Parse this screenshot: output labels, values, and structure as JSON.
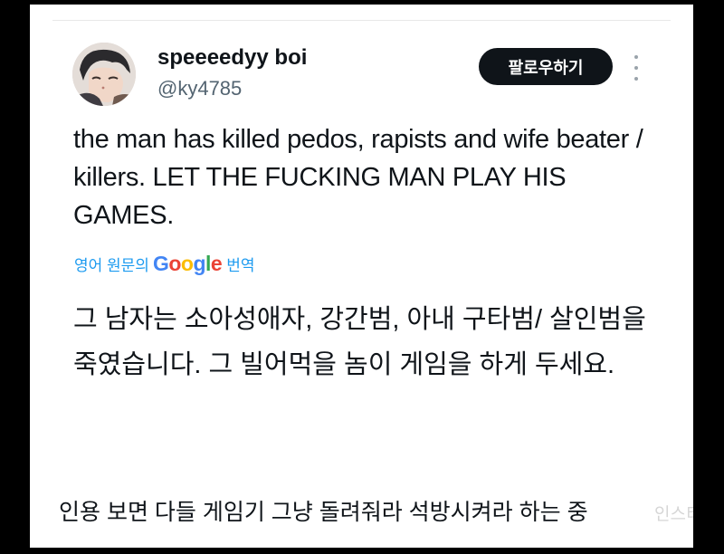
{
  "user": {
    "display_name": "speeeedyy boi",
    "handle": "@ky4785"
  },
  "header": {
    "follow_label": "팔로우하기",
    "more_icon": "more-vertical-icon"
  },
  "tweet": {
    "text": "the man has killed pedos, rapists and wife beater / killers. LET THE FUCKING MAN PLAY HIS GAMES.",
    "translation_prefix": "영어 원문의",
    "translation_logo": "Google",
    "translation_suffix": "번역",
    "translated_text": "그 남자는 소아성애자, 강간범, 아내 구타범/ 살인범을 죽였습니다. 그 빌어먹을 놈이 게임을 하게 두세요."
  },
  "caption": "인용 보면 다들 게임기 그냥 돌려줘라 석방시켜라 하는 중",
  "watermark": "인스티즈",
  "colors": {
    "link_blue": "#1d9bf0",
    "text_primary": "#0f1419",
    "text_secondary": "#536471",
    "button_bg": "#0f1419"
  }
}
